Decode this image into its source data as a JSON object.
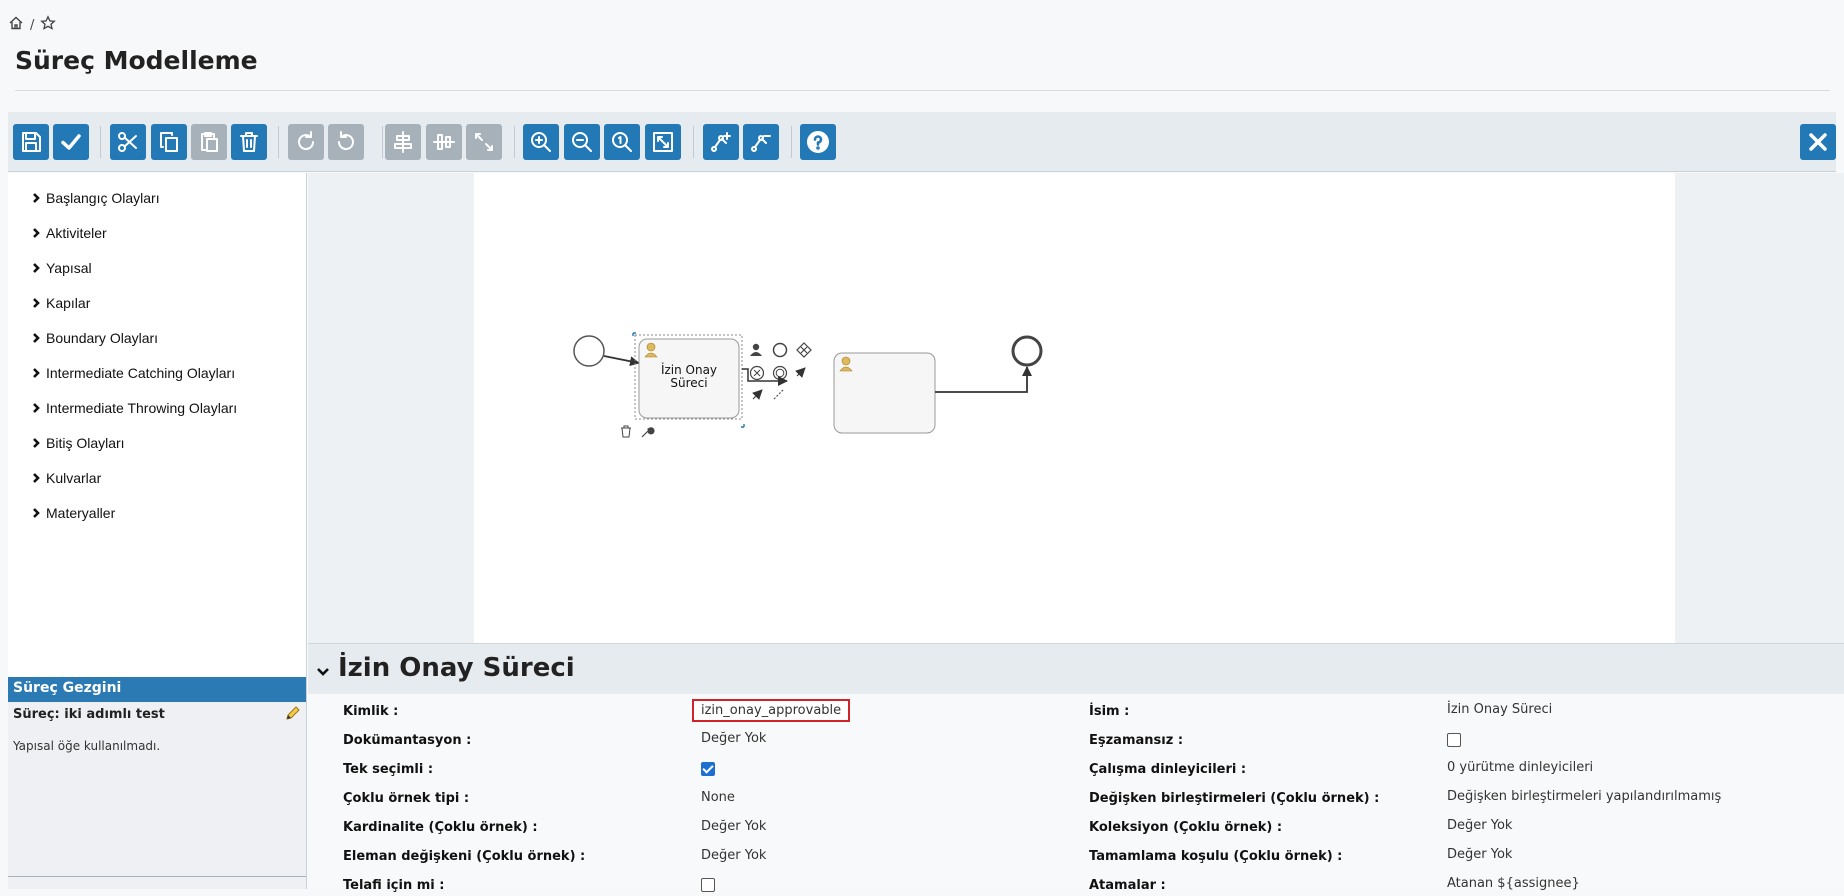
{
  "breadcrumb": {
    "separator": "/",
    "home_icon": "home-icon",
    "star_icon": "star-icon"
  },
  "page": {
    "title": "Süreç Modelleme"
  },
  "toolbar": {
    "buttons": [
      "save",
      "validate",
      "cut",
      "copy",
      "paste",
      "delete",
      "redo",
      "undo",
      "align-horizontal",
      "align-vertical",
      "same-size",
      "zoom-in",
      "zoom-out",
      "zoom-actual",
      "zoom-fit",
      "add-bendpoint",
      "remove-bendpoint",
      "help",
      "close"
    ]
  },
  "palette": {
    "items": [
      {
        "label": "Başlangıç Olayları"
      },
      {
        "label": "Aktiviteler"
      },
      {
        "label": "Yapısal"
      },
      {
        "label": "Kapılar"
      },
      {
        "label": "Boundary Olayları"
      },
      {
        "label": "Intermediate Catching Olayları"
      },
      {
        "label": "Intermediate Throwing Olayları"
      },
      {
        "label": "Bitiş Olayları"
      },
      {
        "label": "Kulvarlar"
      },
      {
        "label": "Materyaller"
      }
    ]
  },
  "navigator": {
    "title": "Süreç Gezgini",
    "process": "Süreç: iki adımlı test",
    "note": "Yapısal öğe kullanılmadı."
  },
  "diagram": {
    "task1_label_line1": "İzin Onay",
    "task1_label_line2": "Süreci",
    "task2_label": ""
  },
  "properties": {
    "title": "İzin Onay Süreci",
    "left": [
      {
        "label": "Kimlik :",
        "value": "izin_onay_approvable",
        "kind": "highlight"
      },
      {
        "label": "Dokümantasyon :",
        "value": "Değer Yok",
        "kind": "text"
      },
      {
        "label": "Tek seçimli :",
        "value": "",
        "kind": "checked"
      },
      {
        "label": "Çoklu örnek tipi :",
        "value": "None",
        "kind": "text"
      },
      {
        "label": "Kardinalite (Çoklu örnek) :",
        "value": "Değer Yok",
        "kind": "text"
      },
      {
        "label": "Eleman değişkeni (Çoklu örnek) :",
        "value": "Değer Yok",
        "kind": "text"
      },
      {
        "label": "Telafi için mi :",
        "value": "",
        "kind": "unchecked"
      }
    ],
    "right": [
      {
        "label": "İsim :",
        "value": "İzin Onay Süreci",
        "kind": "text"
      },
      {
        "label": "Eşzamansız :",
        "value": "",
        "kind": "unchecked"
      },
      {
        "label": "Çalışma dinleyicileri :",
        "value": "0 yürütme dinleyicileri",
        "kind": "text"
      },
      {
        "label": "Değişken birleştirmeleri (Çoklu örnek) :",
        "value": "Değişken birleştirmeleri yapılandırılmamış",
        "kind": "text"
      },
      {
        "label": "Koleksiyon (Çoklu örnek) :",
        "value": "Değer Yok",
        "kind": "text"
      },
      {
        "label": "Tamamlama koşulu (Çoklu örnek) :",
        "value": "Değer Yok",
        "kind": "text"
      },
      {
        "label": "Atamalar :",
        "value": "Atanan ${assignee}",
        "kind": "text"
      }
    ]
  }
}
